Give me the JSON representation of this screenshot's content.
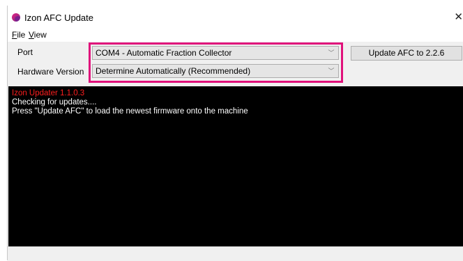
{
  "window": {
    "title": "Izon AFC Update",
    "close_glyph": "✕"
  },
  "menu": {
    "items": [
      {
        "accel": "F",
        "rest": "ile"
      },
      {
        "accel": "V",
        "rest": "iew"
      }
    ]
  },
  "form": {
    "port_label": "Port",
    "port_value": "COM4 - Automatic Fraction Collector",
    "hardware_label": "Hardware Version",
    "hardware_value": "Determine Automatically (Recommended)",
    "update_button": "Update AFC to 2.2.6"
  },
  "console": {
    "lines": [
      "Izon Updater 1.1.0.3",
      "Checking for updates....",
      "Press \"Update AFC\" to load the newest firmware onto the machine"
    ]
  },
  "colors": {
    "highlight": "#e0117b",
    "console_bg": "#000000",
    "console_header": "#ff1e1e"
  }
}
